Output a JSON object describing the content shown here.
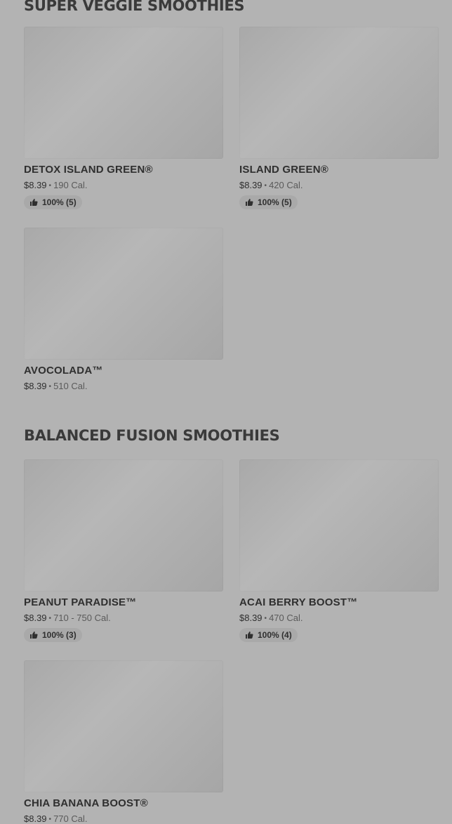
{
  "sections": [
    {
      "title": "SUPER VEGGIE SMOOTHIES",
      "items": [
        {
          "name": "DETOX ISLAND GREEN®",
          "price": "$8.39",
          "calories": "190 Cal.",
          "rating": "100% (5)"
        },
        {
          "name": "ISLAND GREEN®",
          "price": "$8.39",
          "calories": "420 Cal.",
          "rating": "100% (5)"
        },
        {
          "name": "AVOCOLADA™",
          "price": "$8.39",
          "calories": "510 Cal.",
          "rating": null
        }
      ]
    },
    {
      "title": "BALANCED FUSION SMOOTHIES",
      "items": [
        {
          "name": "PEANUT PARADISE™",
          "price": "$8.39",
          "calories": "710 - 750 Cal.",
          "rating": "100% (3)"
        },
        {
          "name": "ACAI BERRY BOOST™",
          "price": "$8.39",
          "calories": "470 Cal.",
          "rating": "100% (4)"
        },
        {
          "name": "CHIA BANANA BOOST®",
          "price": "$8.39",
          "calories": "770 Cal.",
          "rating": null
        }
      ]
    }
  ],
  "separator": "•",
  "icons": {
    "rating": "thumbs-up-icon"
  }
}
